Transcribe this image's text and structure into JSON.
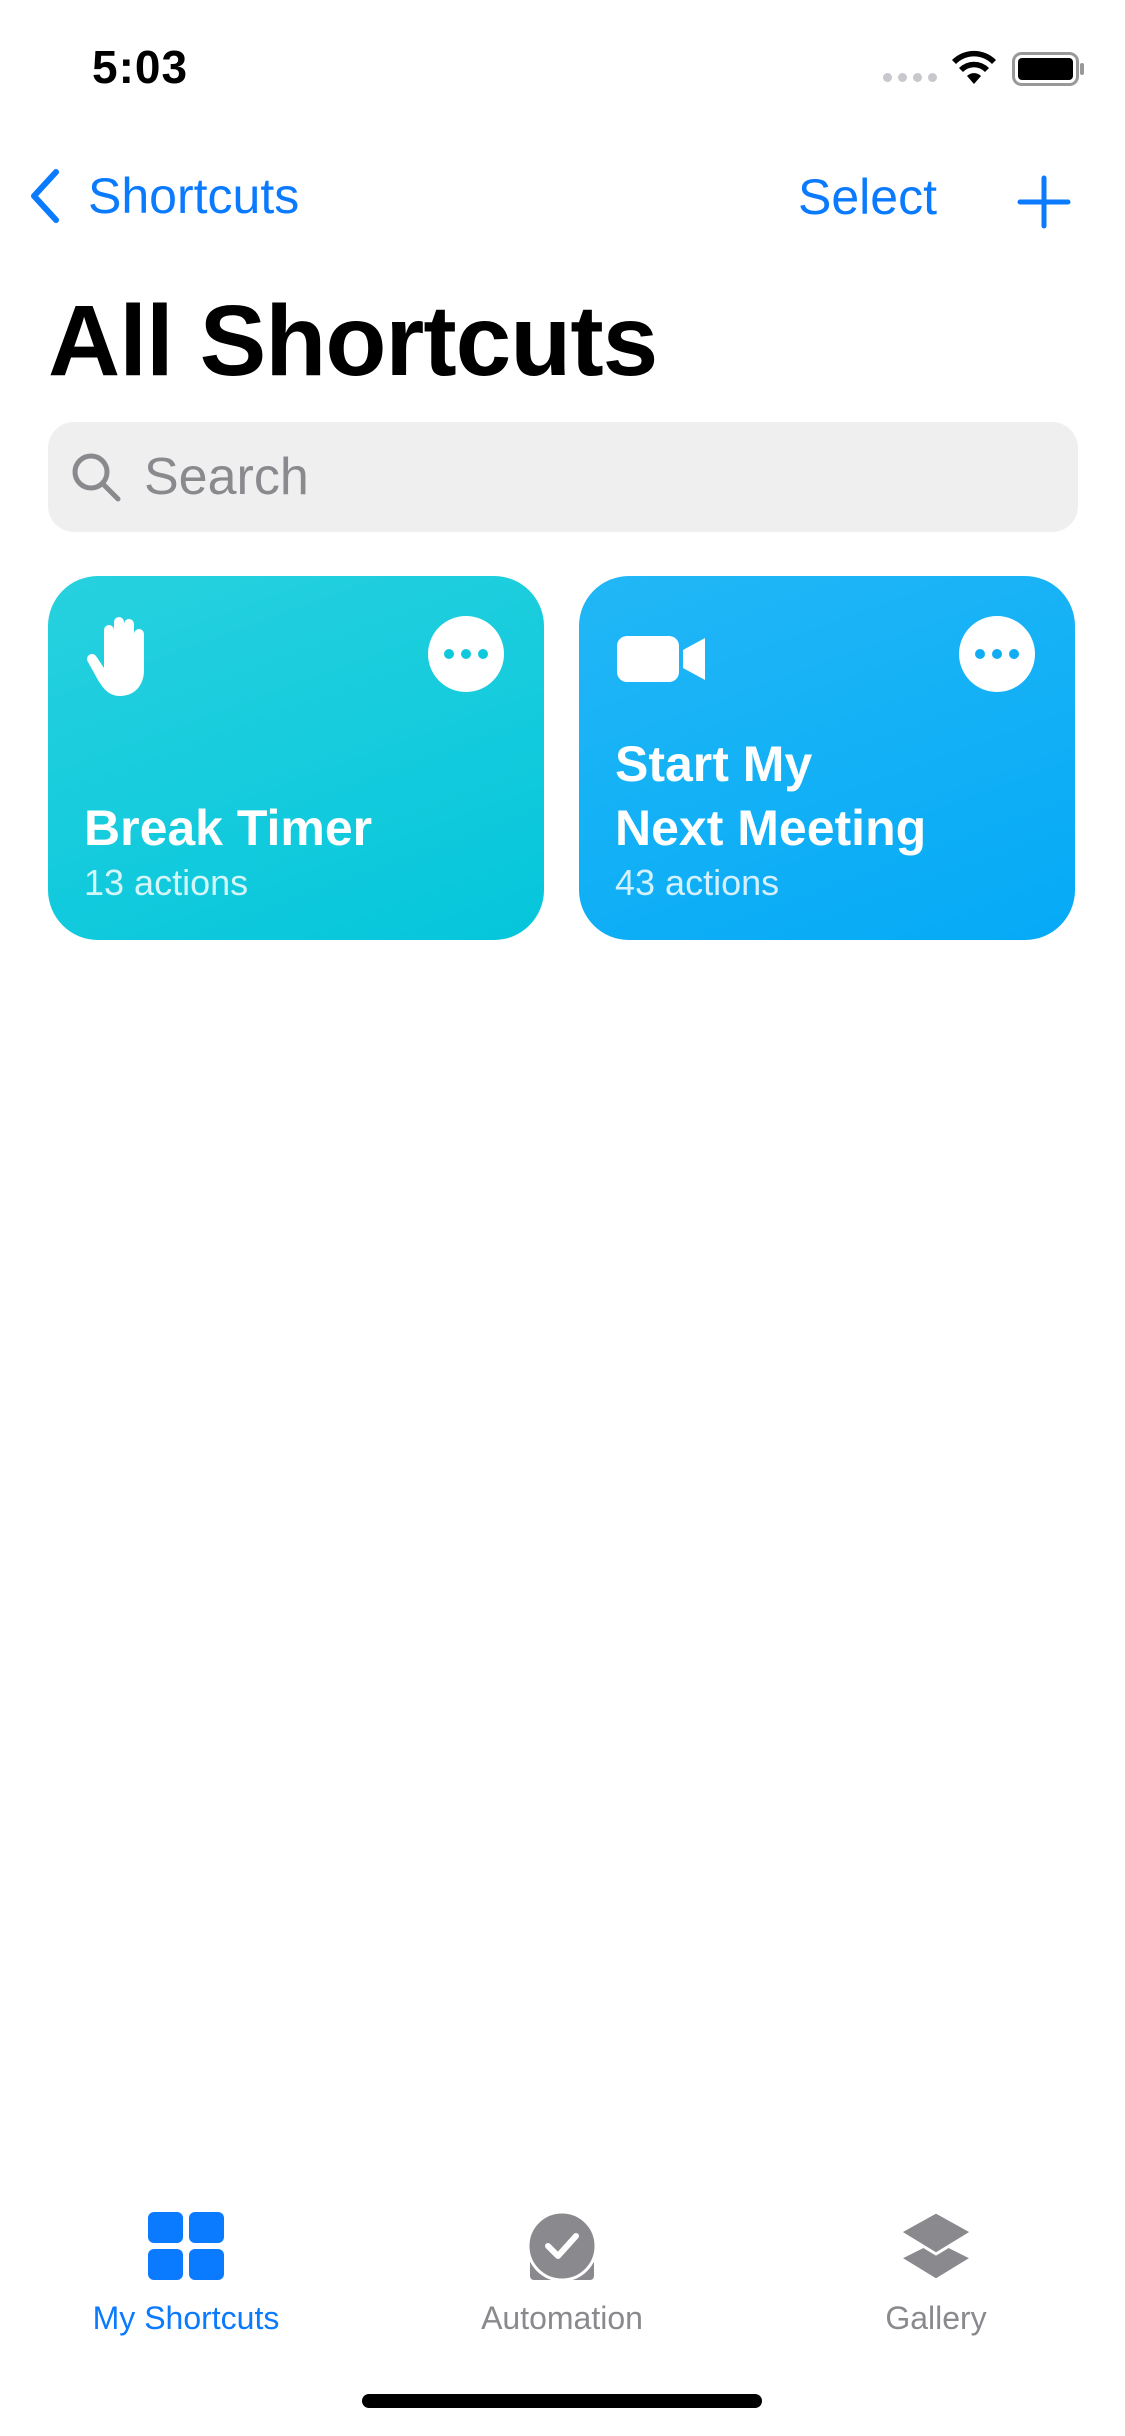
{
  "status_bar": {
    "time": "5:03"
  },
  "nav": {
    "back_label": "Shortcuts",
    "select_label": "Select",
    "add_icon": "plus-icon"
  },
  "page": {
    "title": "All Shortcuts"
  },
  "search": {
    "placeholder": "Search",
    "value": ""
  },
  "shortcuts": [
    {
      "title": "Break Timer",
      "subtitle": "13 actions",
      "icon": "hand-raised-icon",
      "color": "#1acfdd"
    },
    {
      "title": "Start My\nNext Meeting",
      "title_lines": [
        "Start My",
        "Next Meeting"
      ],
      "subtitle": "43 actions",
      "icon": "video-camera-icon",
      "color": "#12b0f6"
    }
  ],
  "tab_bar": {
    "tabs": [
      {
        "label": "My Shortcuts",
        "icon": "grid-icon",
        "selected": true
      },
      {
        "label": "Automation",
        "icon": "clock-check-icon",
        "selected": false
      },
      {
        "label": "Gallery",
        "icon": "layers-icon",
        "selected": false
      }
    ]
  },
  "colors": {
    "accent": "#0a7aff",
    "inactive": "#8a8a8e",
    "search_bg": "#efeff0"
  }
}
